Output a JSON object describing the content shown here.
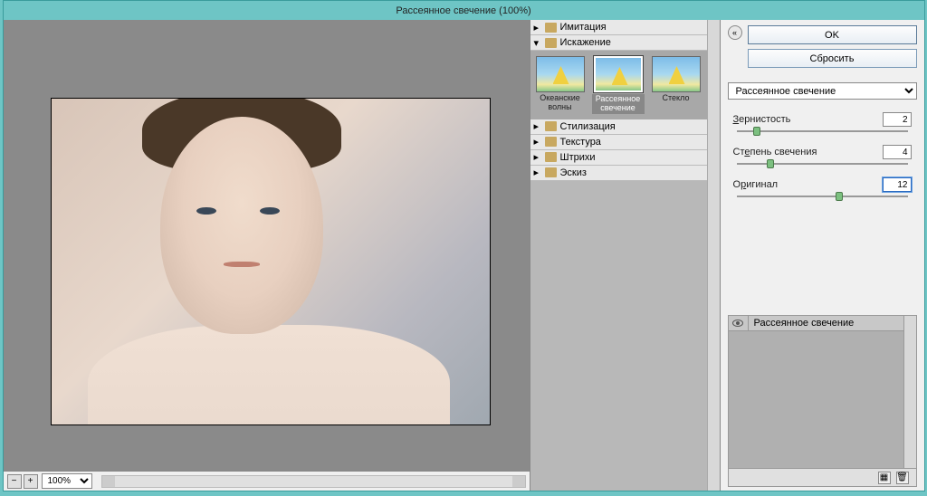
{
  "window": {
    "title": "Рассеянное свечение (100%)"
  },
  "preview": {
    "zoom": "100%"
  },
  "categories": [
    {
      "label": "Имитация",
      "expanded": false
    },
    {
      "label": "Искажение",
      "expanded": true,
      "thumbs": [
        {
          "label": "Океанские волны"
        },
        {
          "label": "Рассеянное свечение",
          "selected": true
        },
        {
          "label": "Стекло"
        }
      ]
    },
    {
      "label": "Стилизация",
      "expanded": false
    },
    {
      "label": "Текстура",
      "expanded": false
    },
    {
      "label": "Штрихи",
      "expanded": false
    },
    {
      "label": "Эскиз",
      "expanded": false
    }
  ],
  "controls": {
    "ok": "OK",
    "reset": "Сбросить",
    "filter_select": "Рассеянное свечение",
    "sliders": {
      "grain": {
        "label": "Зернистость",
        "value": "2",
        "pos": 12
      },
      "glow": {
        "label": "Степень свечения",
        "value": "4",
        "pos": 20
      },
      "clear": {
        "label": "Оригинал",
        "value": "12",
        "pos": 60
      }
    }
  },
  "layers": {
    "current": "Рассеянное свечение"
  }
}
